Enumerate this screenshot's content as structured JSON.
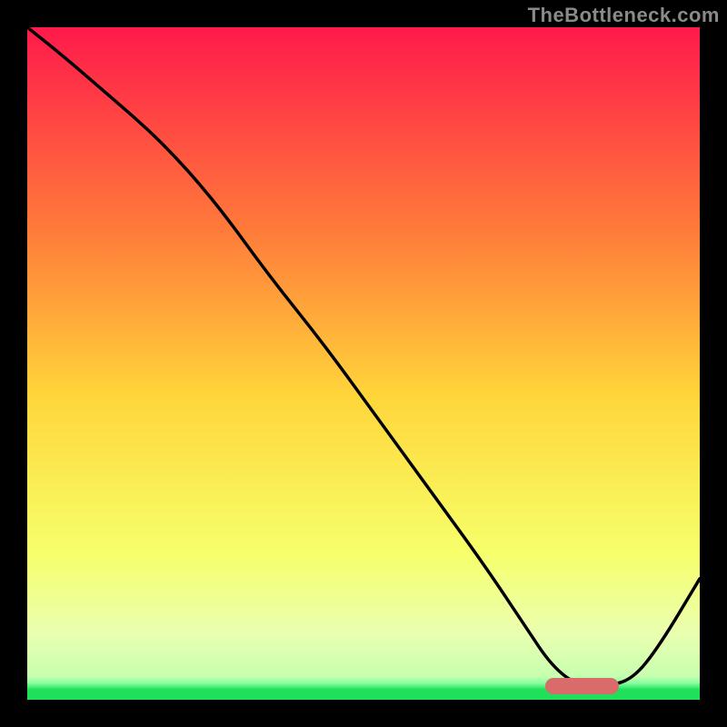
{
  "attribution": "TheBottleneck.com",
  "colors": {
    "top": "#ff1a4b",
    "upper_mid": "#ff7a3a",
    "mid": "#ffd63a",
    "lower_mid": "#f7ff6a",
    "pale": "#eaffb0",
    "green": "#1fe05a",
    "curve": "#000000",
    "marker": "#d96b6b",
    "frame": "#000000"
  },
  "chart_data": {
    "type": "line",
    "title": "",
    "xlabel": "",
    "ylabel": "",
    "xlim": [
      0,
      100
    ],
    "ylim": [
      0,
      100
    ],
    "x": [
      0,
      5,
      12,
      20,
      28,
      36,
      44,
      52,
      60,
      68,
      74,
      78,
      82,
      86,
      90,
      94,
      100
    ],
    "values": [
      100,
      96,
      90,
      83,
      74,
      63,
      53,
      42,
      31,
      20,
      11,
      5,
      2,
      2,
      3,
      8,
      18
    ],
    "marker": {
      "x_start": 77,
      "x_end": 88,
      "y": 2
    },
    "gradient_stops": [
      {
        "offset": 0.0,
        "color": "#ff1a4b"
      },
      {
        "offset": 0.3,
        "color": "#ff7a3a"
      },
      {
        "offset": 0.55,
        "color": "#ffd63a"
      },
      {
        "offset": 0.78,
        "color": "#f7ff6a"
      },
      {
        "offset": 0.9,
        "color": "#eaffb0"
      },
      {
        "offset": 0.965,
        "color": "#c8ffb0"
      },
      {
        "offset": 0.975,
        "color": "#8affa0"
      },
      {
        "offset": 0.985,
        "color": "#1fe05a"
      },
      {
        "offset": 1.0,
        "color": "#1fe05a"
      }
    ]
  }
}
